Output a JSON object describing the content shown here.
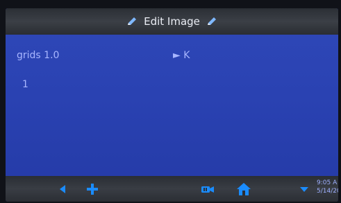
{
  "header": {
    "title": "Edit Image"
  },
  "content": {
    "item_label": "grids 1.0",
    "item_value": "► K",
    "row_number": "1"
  },
  "footer": {
    "time": "9:05 A",
    "date": "5/14/20"
  },
  "icons": {
    "title_left": "pencil-icon",
    "title_right": "pencil-icon",
    "back": "back-arrow-icon",
    "add": "plus-icon",
    "media": "camera-icon",
    "home": "home-icon",
    "wifi": "wifi-icon"
  },
  "colors": {
    "screen_blue": "#2f48b8",
    "text_blue": "#a8b6ff",
    "accent_blue": "#1a8cff",
    "bar_dark": "#2f3339"
  }
}
